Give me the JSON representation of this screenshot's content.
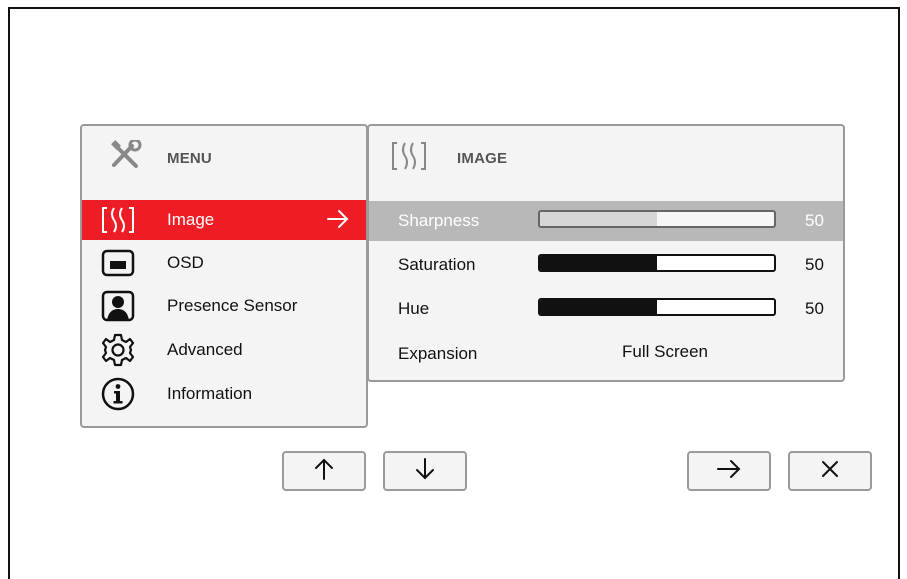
{
  "menu": {
    "title": "MENU",
    "items": [
      {
        "label": "Image",
        "icon": "image-icon",
        "selected": true
      },
      {
        "label": "OSD",
        "icon": "osd-icon",
        "selected": false
      },
      {
        "label": "Presence Sensor",
        "icon": "presence-sensor-icon",
        "selected": false
      },
      {
        "label": "Advanced",
        "icon": "gear-icon",
        "selected": false
      },
      {
        "label": "Information",
        "icon": "info-icon",
        "selected": false
      }
    ]
  },
  "image_panel": {
    "title": "IMAGE",
    "settings": [
      {
        "label": "Sharpness",
        "value": "50",
        "level": 50,
        "highlighted": true
      },
      {
        "label": "Saturation",
        "value": "50",
        "level": 50,
        "highlighted": false
      },
      {
        "label": "Hue",
        "value": "50",
        "level": 50,
        "highlighted": false
      }
    ],
    "expansion": {
      "label": "Expansion",
      "value": "Full Screen"
    }
  },
  "buttons": {
    "up": "up-arrow-icon",
    "down": "down-arrow-icon",
    "right": "right-arrow-icon",
    "close": "close-icon"
  },
  "colors": {
    "selected": "#ee1c24",
    "highlight": "#b8b8b8",
    "panel": "#f4f4f4"
  }
}
